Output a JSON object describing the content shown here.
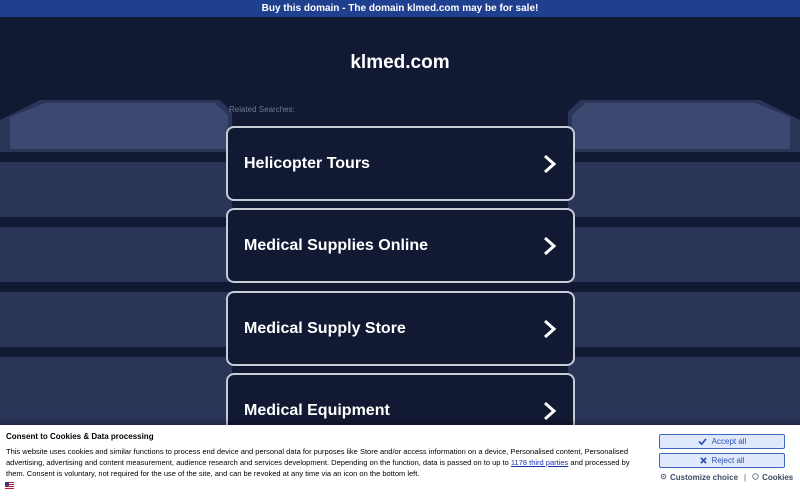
{
  "banner": {
    "text": "Buy this domain - The domain klmed.com may be for sale!"
  },
  "page": {
    "domain": "klmed.com",
    "related_label": "Related Searches:"
  },
  "search_cards": [
    {
      "label": "Helicopter Tours"
    },
    {
      "label": "Medical Supplies Online"
    },
    {
      "label": "Medical Supply Store"
    },
    {
      "label": "Medical Equipment"
    }
  ],
  "consent": {
    "title": "Consent to Cookies & Data processing",
    "text_before": "This website uses cookies and similar functions to process end device and personal data for purposes like Store and/or access information on a device, Personalised content, Personalised advertising, advertising and content measurement, audience research and services development. Depending on the function, data is passed on to up to ",
    "third_parties_link": "1178 third parties",
    "text_after": " and processed by them. Consent is voluntary, not required for the use of the site, and can be revoked at any time via an icon on the bottom left.",
    "accept_label": "Accept all",
    "reject_label": "Reject all",
    "customize_label": "Customize choice",
    "separator": "|",
    "cookies_label": "Cookies"
  },
  "colors": {
    "background": "#121a33",
    "banner": "#1f3f8f",
    "card_border": "#c7cbd6",
    "button_text": "#2b53b6"
  },
  "icons": [
    "chevron-right-icon",
    "check-icon",
    "x-icon",
    "gear-icon",
    "cookie-icon",
    "flag-icon"
  ]
}
